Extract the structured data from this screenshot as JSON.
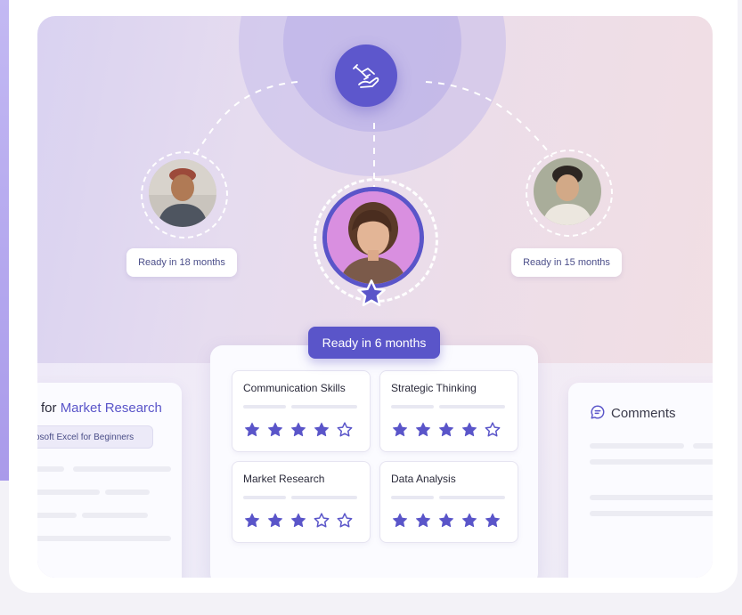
{
  "hub": {
    "icon": "handshake-icon"
  },
  "candidates": {
    "left": {
      "ready_label": "Ready in 18 months"
    },
    "right": {
      "ready_label": "Ready in 15 months"
    },
    "center": {
      "ready_label": "Ready in 6 months",
      "badge_icon": "star-icon"
    }
  },
  "skills": [
    {
      "name": "Communication Skills",
      "rating": 4,
      "max": 5
    },
    {
      "name": "Strategic Thinking",
      "rating": 4,
      "max": 5
    },
    {
      "name": "Market Research",
      "rating": 3,
      "max": 5
    },
    {
      "name": "Data Analysis",
      "rating": 5,
      "max": 5
    }
  ],
  "left_card": {
    "title_prefix": "for",
    "title_accent": "Market Research",
    "course": "osoft Excel for Beginners"
  },
  "comments_card": {
    "title": "Comments",
    "icon": "comment-icon"
  },
  "colors": {
    "accent": "#5a55c9",
    "star": "#5a55c9"
  }
}
